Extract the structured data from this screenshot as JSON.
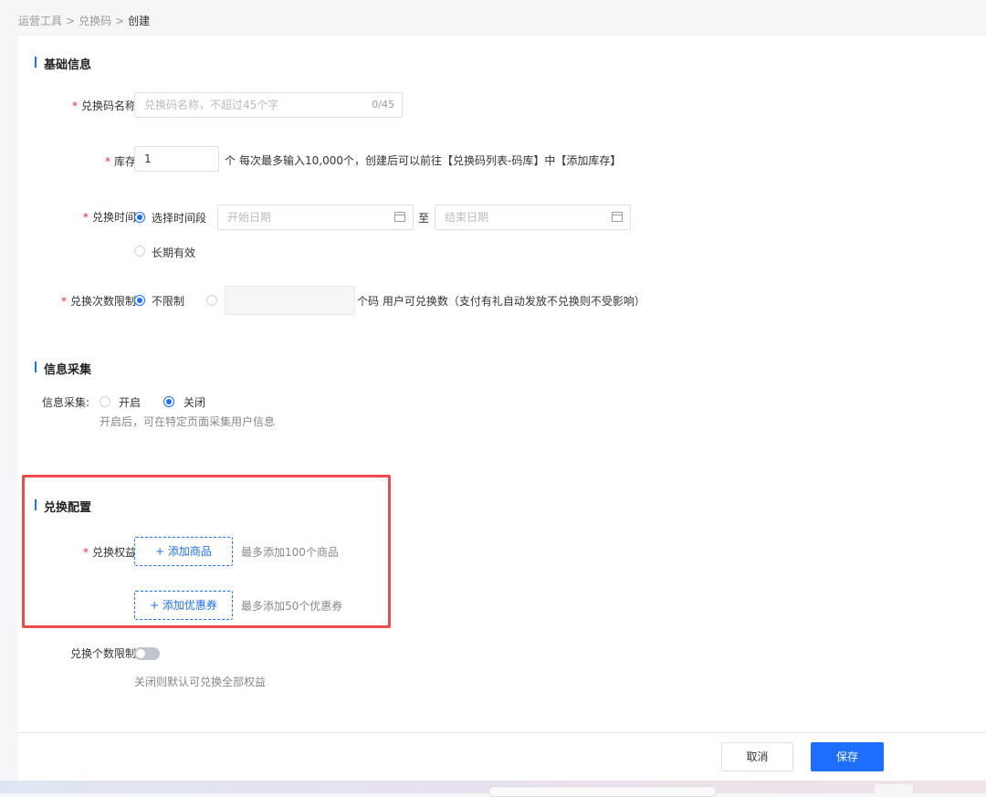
{
  "breadcrumb": {
    "items": [
      "运营工具",
      "兑换码"
    ],
    "current": "创建",
    "separator": ">"
  },
  "sections": {
    "basic": "基础信息",
    "info_collect": "信息采集",
    "exchange_config": "兑换配置"
  },
  "form": {
    "name": {
      "required": "*",
      "label": "兑换码名称:",
      "placeholder": "兑换码名称，不超过45个字",
      "counter": "0/45"
    },
    "stock": {
      "required": "*",
      "label": "库存:",
      "value": "1",
      "unit": "个",
      "hint": "每次最多输入10,000个，创建后可以前往【兑换码列表-码库】中【添加库存】"
    },
    "exchange_time": {
      "required": "*",
      "label": "兑换时间:",
      "option_period": "选择时间段",
      "start_placeholder": "开始日期",
      "to": "至",
      "end_placeholder": "结束日期",
      "option_forever": "长期有效"
    },
    "limit": {
      "required": "*",
      "label": "兑换次数限制:",
      "option_unlimited": "不限制",
      "suffix": "个码 用户可兑换数（支付有礼自动发放不兑换则不受影响）"
    },
    "collect": {
      "label": "信息采集:",
      "option_on": "开启",
      "option_off": "关闭",
      "hint": "开启后，可在特定页面采集用户信息"
    },
    "benefits": {
      "required": "*",
      "label": "兑换权益:",
      "add_product": "+ 添加商品",
      "product_hint": "最多添加100个商品",
      "add_coupon": "+ 添加优惠券",
      "coupon_hint": "最多添加50个优惠券"
    },
    "count_limit": {
      "label": "兑换个数限制:",
      "hint": "关闭则默认可兑换全部权益",
      "enabled": false
    }
  },
  "footer": {
    "cancel": "取消",
    "save": "保存"
  },
  "colors": {
    "accent": "#1e6fff",
    "required": "#f5222d",
    "highlight": "#ef4a4a"
  }
}
